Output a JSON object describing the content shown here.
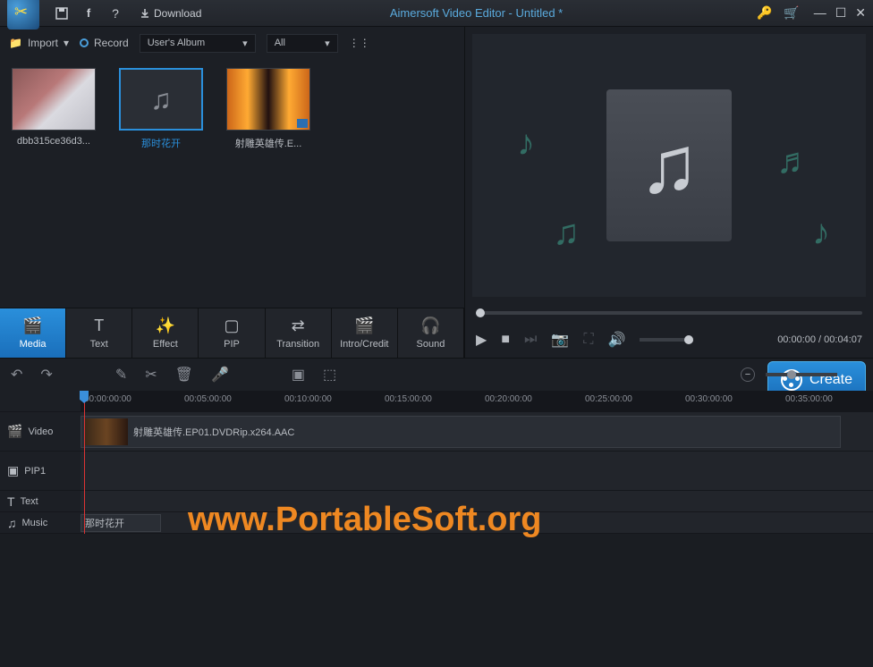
{
  "titlebar": {
    "title": "Aimersoft Video Editor - Untitled *",
    "download": "Download"
  },
  "media": {
    "import": "Import",
    "record": "Record",
    "album_dropdown": "User's Album",
    "filter_dropdown": "All",
    "thumbs": [
      {
        "label": "dbb315ce36d3..."
      },
      {
        "label": "那时花开"
      },
      {
        "label": "射雕英雄传.E..."
      }
    ]
  },
  "tabs": [
    {
      "label": "Media",
      "icon": "🎬"
    },
    {
      "label": "Text",
      "icon": "T"
    },
    {
      "label": "Effect",
      "icon": "✨"
    },
    {
      "label": "PIP",
      "icon": "▢"
    },
    {
      "label": "Transition",
      "icon": "⇄"
    },
    {
      "label": "Intro/Credit",
      "icon": "🎬"
    },
    {
      "label": "Sound",
      "icon": "🎧"
    }
  ],
  "preview": {
    "time": "00:00:00 / 00:04:07"
  },
  "create_button": "Create",
  "timeline": {
    "ruler": [
      "00:00:00:00",
      "00:05:00:00",
      "00:10:00:00",
      "00:15:00:00",
      "00:20:00:00",
      "00:25:00:00",
      "00:30:00:00",
      "00:35:00:00"
    ],
    "tracks": {
      "video": "Video",
      "pip": "PIP1",
      "text": "Text",
      "music": "Music"
    },
    "clip_video": "射雕英雄传.EP01.DVDRip.x264.AAC",
    "clip_music": "那时花开"
  },
  "watermark": "www.PortableSoft.org"
}
